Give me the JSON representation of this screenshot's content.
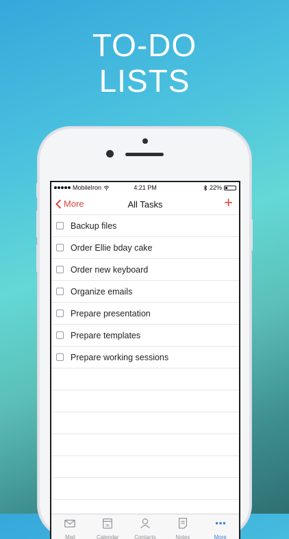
{
  "headline": {
    "line1": "TO-DO",
    "line2": "LISTS"
  },
  "status_bar": {
    "carrier": "MobileIron",
    "time": "4:21 PM",
    "battery": "22%",
    "battery_level": 0.22
  },
  "nav": {
    "back_label": "More",
    "title": "All Tasks",
    "add_label": "+"
  },
  "tasks": [
    {
      "label": "Backup files",
      "checked": false
    },
    {
      "label": "Order Ellie bday cake",
      "checked": false
    },
    {
      "label": "Order new keyboard",
      "checked": false
    },
    {
      "label": "Organize emails",
      "checked": false
    },
    {
      "label": "Prepare presentation",
      "checked": false
    },
    {
      "label": "Prepare templates",
      "checked": false
    },
    {
      "label": "Prepare working sessions",
      "checked": false
    }
  ],
  "tabs": [
    {
      "label": "Mail",
      "icon": "mail-icon",
      "active": false
    },
    {
      "label": "Calendar",
      "icon": "calendar-icon",
      "calendar_day": "36",
      "active": false
    },
    {
      "label": "Contacts",
      "icon": "contacts-icon",
      "active": false
    },
    {
      "label": "Notes",
      "icon": "notes-icon",
      "active": false
    },
    {
      "label": "More",
      "icon": "more-icon",
      "active": true
    }
  ],
  "colors": {
    "accent": "#e0433a",
    "tab_active": "#3a7bd5",
    "tab_inactive": "#8e8e93"
  }
}
